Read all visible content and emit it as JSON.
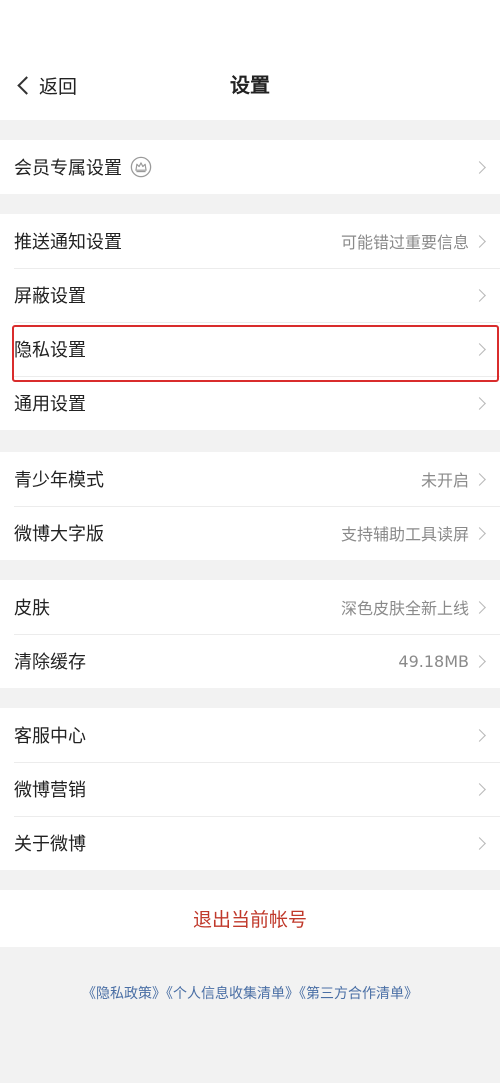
{
  "nav": {
    "back_label": "返回",
    "title": "设置"
  },
  "groups": [
    {
      "rows": [
        {
          "label": "会员专属设置",
          "value": "",
          "icon": "crown-icon"
        }
      ]
    },
    {
      "rows": [
        {
          "label": "推送通知设置",
          "value": "可能错过重要信息"
        },
        {
          "label": "屏蔽设置",
          "value": ""
        },
        {
          "label": "隐私设置",
          "value": "",
          "highlighted": true
        },
        {
          "label": "通用设置",
          "value": ""
        }
      ]
    },
    {
      "rows": [
        {
          "label": "青少年模式",
          "value": "未开启"
        },
        {
          "label": "微博大字版",
          "value": "支持辅助工具读屏"
        }
      ]
    },
    {
      "rows": [
        {
          "label": "皮肤",
          "value": "深色皮肤全新上线"
        },
        {
          "label": "清除缓存",
          "value": "49.18MB"
        }
      ]
    },
    {
      "rows": [
        {
          "label": "客服中心",
          "value": ""
        },
        {
          "label": "微博营销",
          "value": ""
        },
        {
          "label": "关于微博",
          "value": ""
        }
      ]
    }
  ],
  "logout_label": "退出当前帐号",
  "footer": {
    "privacy_policy": "《隐私政策》",
    "personal_info_list": "《个人信息收集清单》",
    "third_party_list": "《第三方合作清单》"
  },
  "colors": {
    "highlight_border": "#d92c2c",
    "logout_text": "#c0392b",
    "footer_link": "#4a6fa5"
  }
}
